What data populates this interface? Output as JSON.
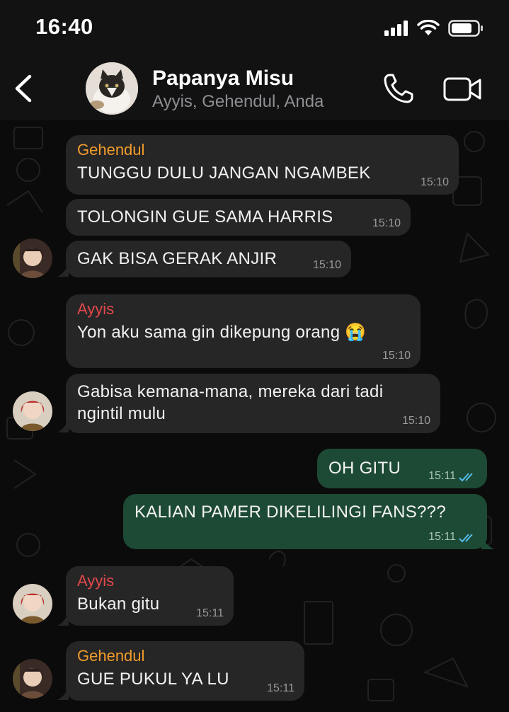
{
  "status_bar": {
    "time": "16:40"
  },
  "header": {
    "title": "Papanya Misu",
    "members": "Ayyis, Gehendul, Anda"
  },
  "colors": {
    "incoming_bubble": "#262626",
    "outgoing_bubble": "#1d4a35",
    "sender_gehendul": "#f29c2b",
    "sender_ayyis": "#e5484d",
    "read_ticks": "#53bdeb"
  },
  "messages": [
    {
      "sender": "Gehendul",
      "text": "TUNGGU DULU JANGAN NGAMBEK",
      "time": "15:10",
      "direction": "in"
    },
    {
      "text": "TOLONGIN GUE SAMA HARRIS",
      "time": "15:10",
      "direction": "in"
    },
    {
      "text": "GAK BISA GERAK ANJIR",
      "time": "15:10",
      "direction": "in"
    },
    {
      "sender": "Ayyis",
      "text": "Yon aku sama gin dikepung orang 😭",
      "time": "15:10",
      "direction": "in"
    },
    {
      "text_line1": "Gabisa kemana-mana, mereka dari tadi",
      "text_line2": "ngintil mulu",
      "time": "15:10",
      "direction": "in"
    },
    {
      "text": "OH GITU",
      "time": "15:11",
      "direction": "out"
    },
    {
      "text": "KALIAN PAMER DIKELILINGI FANS???",
      "time": "15:11",
      "direction": "out"
    },
    {
      "sender": "Ayyis",
      "text": "Bukan gitu",
      "time": "15:11",
      "direction": "in"
    },
    {
      "sender": "Gehendul",
      "text": "GUE PUKUL YA LU",
      "time": "15:11",
      "direction": "in"
    }
  ]
}
